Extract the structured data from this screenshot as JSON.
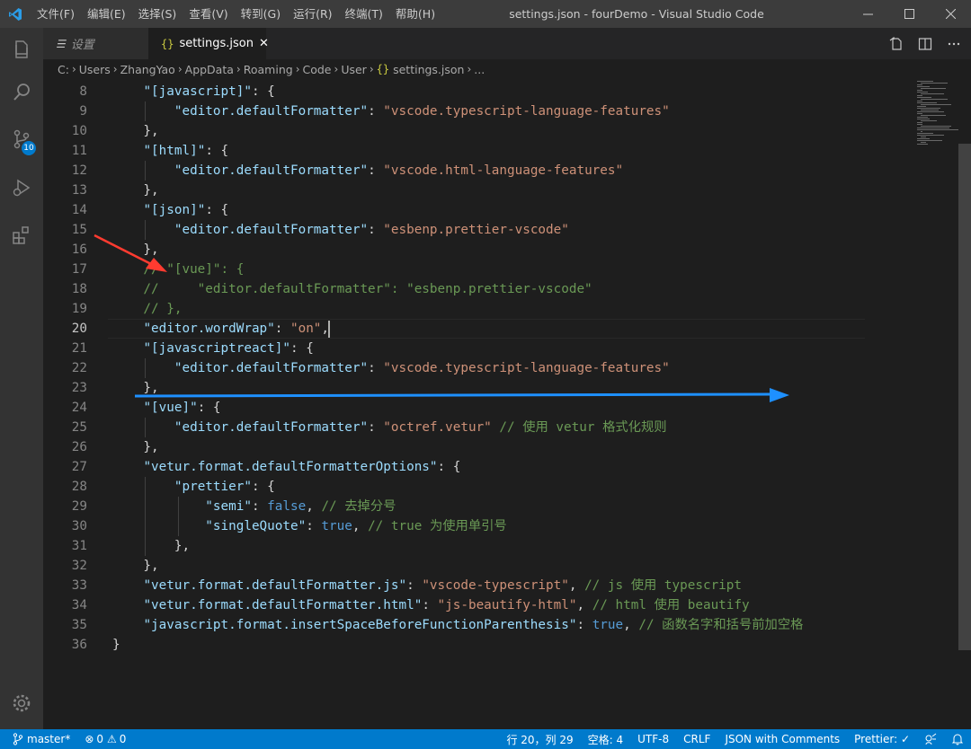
{
  "window": {
    "title": "settings.json - fourDemo - Visual Studio Code",
    "menu": [
      "文件(F)",
      "编辑(E)",
      "选择(S)",
      "查看(V)",
      "转到(G)",
      "运行(R)",
      "终端(T)",
      "帮助(H)"
    ]
  },
  "activity_bar": {
    "scm_badge": "10",
    "items": [
      "files-icon",
      "search-icon",
      "source-control-icon",
      "run-debug-icon",
      "extensions-icon",
      "settings-gear-icon"
    ]
  },
  "tabs": [
    {
      "label": "设置",
      "icon": "list-icon",
      "active": false
    },
    {
      "label": "settings.json",
      "icon": "{}",
      "active": true
    }
  ],
  "breadcrumb": {
    "items": [
      "C:",
      "Users",
      "ZhangYao",
      "AppData",
      "Roaming",
      "Code",
      "User"
    ],
    "file": "settings.json",
    "tail": "..."
  },
  "editor": {
    "current_line": 20,
    "lines": [
      {
        "n": "8",
        "t": [
          [
            "p",
            "    "
          ],
          [
            "k",
            "\"[javascript]\""
          ],
          [
            "p",
            ": {"
          ]
        ]
      },
      {
        "n": "9",
        "t": [
          [
            "p",
            "        "
          ],
          [
            "k",
            "\"editor.defaultFormatter\""
          ],
          [
            "p",
            ": "
          ],
          [
            "s",
            "\"vscode.typescript-language-features\""
          ]
        ]
      },
      {
        "n": "10",
        "t": [
          [
            "p",
            "    },"
          ]
        ]
      },
      {
        "n": "11",
        "t": [
          [
            "p",
            "    "
          ],
          [
            "k",
            "\"[html]\""
          ],
          [
            "p",
            ": {"
          ]
        ]
      },
      {
        "n": "12",
        "t": [
          [
            "p",
            "        "
          ],
          [
            "k",
            "\"editor.defaultFormatter\""
          ],
          [
            "p",
            ": "
          ],
          [
            "s",
            "\"vscode.html-language-features\""
          ]
        ]
      },
      {
        "n": "13",
        "t": [
          [
            "p",
            "    },"
          ]
        ]
      },
      {
        "n": "14",
        "t": [
          [
            "p",
            "    "
          ],
          [
            "k",
            "\"[json]\""
          ],
          [
            "p",
            ": {"
          ]
        ]
      },
      {
        "n": "15",
        "t": [
          [
            "p",
            "        "
          ],
          [
            "k",
            "\"editor.defaultFormatter\""
          ],
          [
            "p",
            ": "
          ],
          [
            "s",
            "\"esbenp.prettier-vscode\""
          ]
        ]
      },
      {
        "n": "16",
        "t": [
          [
            "p",
            "    },"
          ]
        ]
      },
      {
        "n": "17",
        "t": [
          [
            "c",
            "    // \"[vue]\": {"
          ]
        ]
      },
      {
        "n": "18",
        "t": [
          [
            "c",
            "    //     \"editor.defaultFormatter\": \"esbenp.prettier-vscode\""
          ]
        ]
      },
      {
        "n": "19",
        "t": [
          [
            "c",
            "    // },"
          ]
        ]
      },
      {
        "n": "20",
        "t": [
          [
            "p",
            "    "
          ],
          [
            "k",
            "\"editor.wordWrap\""
          ],
          [
            "p",
            ": "
          ],
          [
            "s",
            "\"on\""
          ],
          [
            "p",
            ","
          ],
          [
            "cursor",
            ""
          ]
        ]
      },
      {
        "n": "21",
        "t": [
          [
            "p",
            "    "
          ],
          [
            "k",
            "\"[javascriptreact]\""
          ],
          [
            "p",
            ": {"
          ]
        ]
      },
      {
        "n": "22",
        "t": [
          [
            "p",
            "        "
          ],
          [
            "k",
            "\"editor.defaultFormatter\""
          ],
          [
            "p",
            ": "
          ],
          [
            "s",
            "\"vscode.typescript-language-features\""
          ]
        ]
      },
      {
        "n": "23",
        "t": [
          [
            "p",
            "    },"
          ]
        ]
      },
      {
        "n": "24",
        "t": [
          [
            "p",
            "    "
          ],
          [
            "k",
            "\"[vue]\""
          ],
          [
            "p",
            ": {"
          ]
        ]
      },
      {
        "n": "25",
        "t": [
          [
            "p",
            "        "
          ],
          [
            "k",
            "\"editor.defaultFormatter\""
          ],
          [
            "p",
            ": "
          ],
          [
            "s",
            "\"octref.vetur\""
          ],
          [
            "p",
            " "
          ],
          [
            "c",
            "// 使用 vetur 格式化规则"
          ]
        ]
      },
      {
        "n": "26",
        "t": [
          [
            "p",
            "    },"
          ]
        ]
      },
      {
        "n": "27",
        "t": [
          [
            "p",
            "    "
          ],
          [
            "k",
            "\"vetur.format.defaultFormatterOptions\""
          ],
          [
            "p",
            ": {"
          ]
        ]
      },
      {
        "n": "28",
        "t": [
          [
            "p",
            "        "
          ],
          [
            "k",
            "\"prettier\""
          ],
          [
            "p",
            ": {"
          ]
        ]
      },
      {
        "n": "29",
        "t": [
          [
            "p",
            "            "
          ],
          [
            "k",
            "\"semi\""
          ],
          [
            "p",
            ": "
          ],
          [
            "b",
            "false"
          ],
          [
            "p",
            ", "
          ],
          [
            "c",
            "// 去掉分号"
          ]
        ]
      },
      {
        "n": "30",
        "t": [
          [
            "p",
            "            "
          ],
          [
            "k",
            "\"singleQuote\""
          ],
          [
            "p",
            ": "
          ],
          [
            "b",
            "true"
          ],
          [
            "p",
            ", "
          ],
          [
            "c",
            "// true 为使用单引号"
          ]
        ]
      },
      {
        "n": "31",
        "t": [
          [
            "p",
            "        },"
          ]
        ]
      },
      {
        "n": "32",
        "t": [
          [
            "p",
            "    },"
          ]
        ]
      },
      {
        "n": "33",
        "t": [
          [
            "p",
            "    "
          ],
          [
            "k",
            "\"vetur.format.defaultFormatter.js\""
          ],
          [
            "p",
            ": "
          ],
          [
            "s",
            "\"vscode-typescript\""
          ],
          [
            "p",
            ", "
          ],
          [
            "c",
            "// js 使用 typescript"
          ]
        ]
      },
      {
        "n": "34",
        "t": [
          [
            "p",
            "    "
          ],
          [
            "k",
            "\"vetur.format.defaultFormatter.html\""
          ],
          [
            "p",
            ": "
          ],
          [
            "s",
            "\"js-beautify-html\""
          ],
          [
            "p",
            ", "
          ],
          [
            "c",
            "// html 使用 beautify"
          ]
        ]
      },
      {
        "n": "35",
        "t": [
          [
            "p",
            "    "
          ],
          [
            "k",
            "\"javascript.format.insertSpaceBeforeFunctionParenthesis\""
          ],
          [
            "p",
            ": "
          ],
          [
            "b",
            "true"
          ],
          [
            "p",
            ", "
          ],
          [
            "c",
            "// 函数名字和括号前加空格"
          ]
        ]
      },
      {
        "n": "36",
        "t": [
          [
            "p",
            "}"
          ]
        ]
      }
    ]
  },
  "status_bar": {
    "branch": "master*",
    "errors": "0",
    "warnings": "0",
    "position": "行 20，列 29",
    "spaces": "空格: 4",
    "encoding": "UTF-8",
    "eol": "CRLF",
    "language": "JSON with Comments",
    "formatter": "Prettier: ✓"
  },
  "colors": {
    "accent": "#007acc",
    "annotation_red": "#ff3b30",
    "annotation_blue": "#1e90ff"
  }
}
